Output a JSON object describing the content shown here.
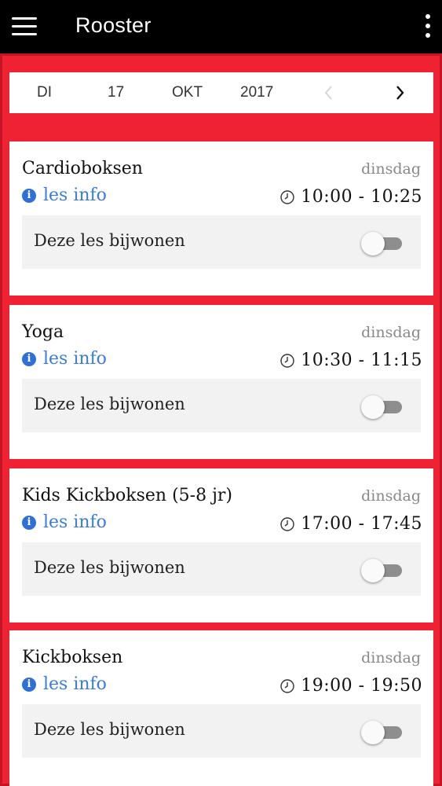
{
  "header": {
    "title": "Rooster",
    "menu_icon": "hamburger-menu-icon",
    "more_icon": "more-vertical-icon"
  },
  "datebar": {
    "day": "DI",
    "date": "17",
    "month": "OKT",
    "year": "2017",
    "prev_icon": "chevron-left-icon",
    "next_icon": "chevron-right-icon"
  },
  "classes": [
    {
      "title": "Cardioboksen",
      "day": "dinsdag",
      "info": "les info",
      "time": "10:00 - 10:25",
      "attend_label": "Deze les bijwonen",
      "attending": false
    },
    {
      "title": "Yoga",
      "day": "dinsdag",
      "info": "les info",
      "time": "10:30 - 11:15",
      "attend_label": "Deze les bijwonen",
      "attending": false
    },
    {
      "title": "Kids Kickboksen (5-8 jr)",
      "day": "dinsdag",
      "info": "les info",
      "time": "17:00 - 17:45",
      "attend_label": "Deze les bijwonen",
      "attending": false
    },
    {
      "title": "Kickboksen",
      "day": "dinsdag",
      "info": "les info",
      "time": "19:00 - 19:50",
      "attend_label": "Deze les bijwonen",
      "attending": false
    }
  ],
  "colors": {
    "background_red": "#ef2233",
    "link_blue": "#3a7be0",
    "toggle_off": "#8e8e8e"
  }
}
